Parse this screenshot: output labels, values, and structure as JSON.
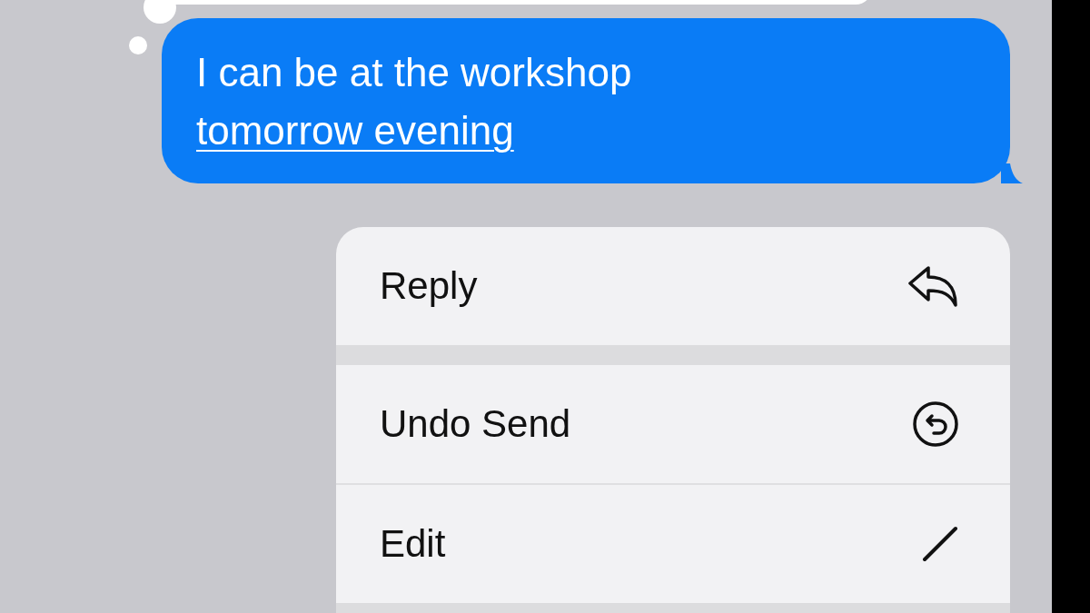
{
  "message": {
    "text": "I can be at the workshop ",
    "link": "tomorrow evening"
  },
  "menu": {
    "sections": [
      [
        {
          "label": "Reply",
          "kind": "reply"
        }
      ],
      [
        {
          "label": "Undo Send",
          "kind": "undo"
        },
        {
          "label": "Edit",
          "kind": "edit"
        }
      ]
    ]
  }
}
